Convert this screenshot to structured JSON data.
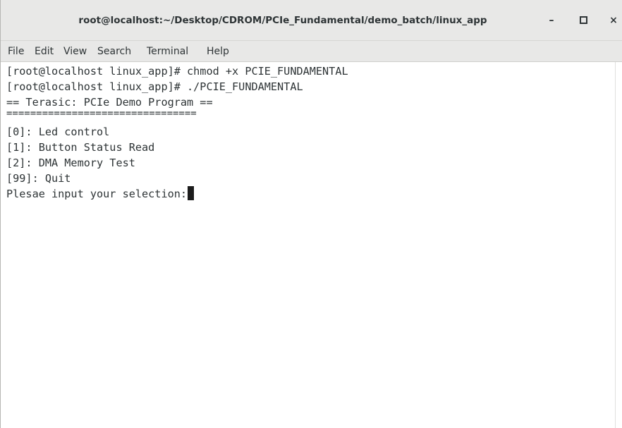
{
  "window": {
    "title": "root@localhost:~/Desktop/CDROM/PCIe_Fundamental/demo_batch/linux_app",
    "minimize_icon": "minimize-icon",
    "maximize_icon": "maximize-icon",
    "close_icon": "close-icon",
    "minimize_glyph": "–",
    "close_glyph": "×"
  },
  "menubar": {
    "items": [
      "File",
      "Edit",
      "View",
      "Search",
      "Terminal",
      "Help"
    ]
  },
  "terminal": {
    "lines": [
      "[root@localhost linux_app]# chmod +x PCIE_FUNDAMENTAL",
      "[root@localhost linux_app]# ./PCIE_FUNDAMENTAL",
      "== Terasic: PCIe Demo Program ==",
      "================================",
      "[0]: Led control",
      "[1]: Button Status Read",
      "[2]: DMA Memory Test",
      "[99]: Quit",
      "Plesae input your selection:"
    ]
  }
}
